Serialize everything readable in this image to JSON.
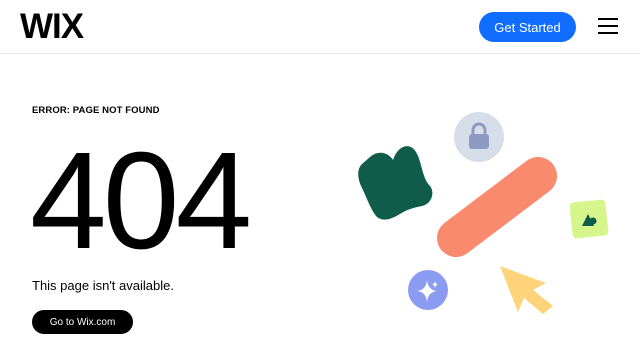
{
  "header": {
    "logo": "WIX",
    "cta_label": "Get Started",
    "menu_icon": "hamburger-menu-icon",
    "accent_color": "#116dff"
  },
  "main": {
    "error_label": "ERROR: PAGE NOT FOUND",
    "code": "404",
    "message": "This page isn't available.",
    "home_button_label": "Go to Wix.com"
  },
  "illustration": {
    "icons": [
      "lock-icon",
      "green-blob-icon",
      "salmon-bar-icon",
      "image-icon",
      "sparkle-icon",
      "cursor-icon"
    ],
    "colors": {
      "lock_bg": "#d6dee9",
      "lock": "#8d9bc4",
      "blob": "#0f5c4b",
      "bar": "#fa8a6e",
      "image_bg": "#d6f58c",
      "image_fg": "#0f5c4b",
      "sparkle_bg": "#8c9bf2",
      "cursor": "#ffd37a"
    }
  }
}
